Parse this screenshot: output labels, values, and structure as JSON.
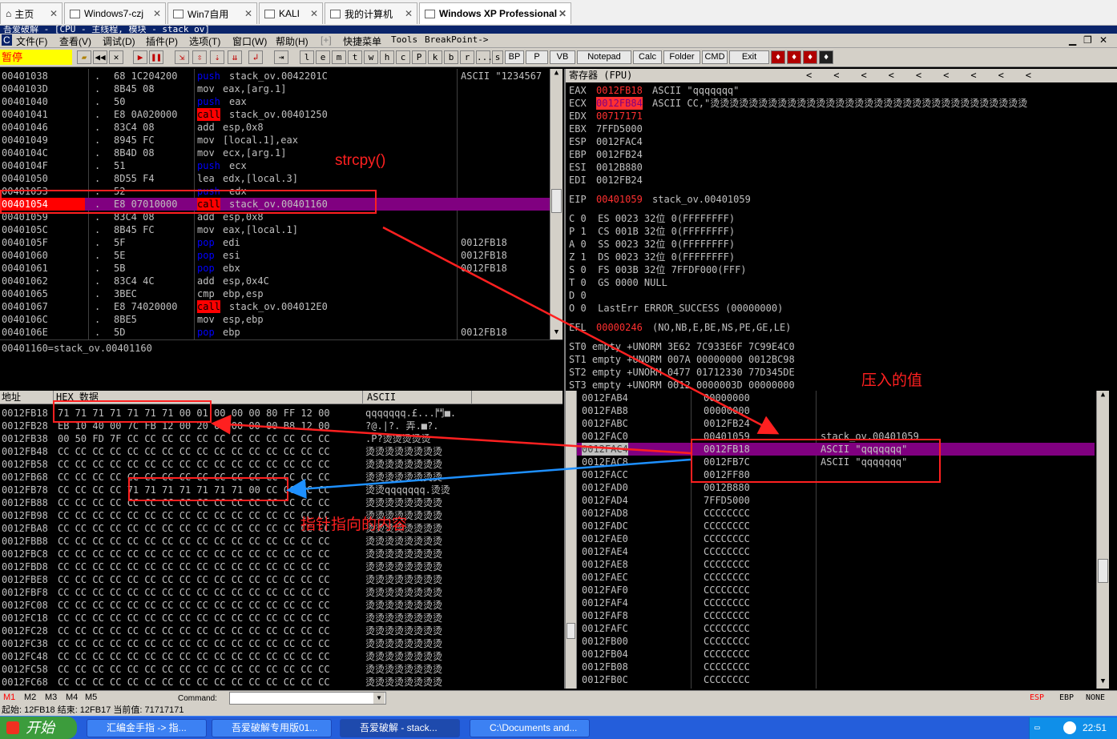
{
  "tabs": [
    {
      "label": "主页",
      "active": false
    },
    {
      "label": "Windows7-czj",
      "active": false
    },
    {
      "label": "Win7自用",
      "active": false
    },
    {
      "label": "KALI",
      "active": false
    },
    {
      "label": "我的计算机",
      "active": false
    },
    {
      "label": "Windows XP Professional",
      "active": true
    }
  ],
  "od_title": "吾爱破解 - [CPU - 主线程, 模块 - stack_ov]",
  "menu": [
    "文件(F)",
    "查看(V)",
    "调试(D)",
    "插件(P)",
    "选项(T)",
    "窗口(W)",
    "帮助(H)",
    "[+]",
    "快捷菜单",
    "Tools",
    "BreakPoint->"
  ],
  "toolbar": {
    "status": "暂停",
    "letters": [
      "l",
      "e",
      "m",
      "t",
      "w",
      "h",
      "c",
      "P",
      "k",
      "b",
      "r",
      "...",
      "s"
    ],
    "text_buttons": [
      "BP",
      "P",
      "VB",
      "Notepad",
      "Calc",
      "Folder",
      "CMD",
      "Exit"
    ]
  },
  "colors": {
    "eip_row": "#800080",
    "call": "#ff0000",
    "push": "#0000ff",
    "annot": "#ff2020",
    "arrow_blue": "#1e90ff"
  },
  "disasm": {
    "rows": [
      {
        "addr": "00401038",
        "mark": ".",
        "hex": "68 1C204200",
        "op": "push",
        "arg": "stack_ov.0042201C",
        "cmt": "ASCII \"1234567"
      },
      {
        "addr": "0040103D",
        "mark": ".",
        "hex": "8B45 08",
        "op": "mov",
        "arg": "eax,[arg.1]",
        "cmt": ""
      },
      {
        "addr": "00401040",
        "mark": ".",
        "hex": "50",
        "op": "push",
        "arg": "eax",
        "cmt": ""
      },
      {
        "addr": "00401041",
        "mark": ".",
        "hex": "E8 0A020000",
        "op": "call",
        "arg": "stack_ov.00401250",
        "cmt": ""
      },
      {
        "addr": "00401046",
        "mark": ".",
        "hex": "83C4 08",
        "op": "add",
        "arg": "esp,0x8",
        "cmt": ""
      },
      {
        "addr": "00401049",
        "mark": ".",
        "hex": "8945 FC",
        "op": "mov",
        "arg": "[local.1],eax",
        "cmt": ""
      },
      {
        "addr": "0040104C",
        "mark": ".",
        "hex": "8B4D 08",
        "op": "mov",
        "arg": "ecx,[arg.1]",
        "cmt": ""
      },
      {
        "addr": "0040104F",
        "mark": ".",
        "hex": "51",
        "op": "push",
        "arg": "ecx",
        "cmt": ""
      },
      {
        "addr": "00401050",
        "mark": ".",
        "hex": "8D55 F4",
        "op": "lea",
        "arg": "edx,[local.3]",
        "cmt": ""
      },
      {
        "addr": "00401053",
        "mark": ".",
        "hex": "52",
        "op": "push",
        "arg": "edx",
        "cmt": ""
      },
      {
        "addr": "00401054",
        "mark": ".",
        "hex": "E8 07010000",
        "op": "call",
        "arg": "stack_ov.00401160",
        "cmt": ""
      },
      {
        "addr": "00401059",
        "mark": ".",
        "hex": "83C4 08",
        "op": "add",
        "arg": "esp,0x8",
        "cmt": ""
      },
      {
        "addr": "0040105C",
        "mark": ".",
        "hex": "8B45 FC",
        "op": "mov",
        "arg": "eax,[local.1]",
        "cmt": ""
      },
      {
        "addr": "0040105F",
        "mark": ".",
        "hex": "5F",
        "op": "pop",
        "arg": "edi",
        "cmt": "0012FB18"
      },
      {
        "addr": "00401060",
        "mark": ".",
        "hex": "5E",
        "op": "pop",
        "arg": "esi",
        "cmt": "0012FB18"
      },
      {
        "addr": "00401061",
        "mark": ".",
        "hex": "5B",
        "op": "pop",
        "arg": "ebx",
        "cmt": "0012FB18"
      },
      {
        "addr": "00401062",
        "mark": ".",
        "hex": "83C4 4C",
        "op": "add",
        "arg": "esp,0x4C",
        "cmt": ""
      },
      {
        "addr": "00401065",
        "mark": ".",
        "hex": "3BEC",
        "op": "cmp",
        "arg": "ebp,esp",
        "cmt": ""
      },
      {
        "addr": "00401067",
        "mark": ".",
        "hex": "E8 74020000",
        "op": "call",
        "arg": "stack_ov.004012E0",
        "cmt": ""
      },
      {
        "addr": "0040106C",
        "mark": ".",
        "hex": "8BE5",
        "op": "mov",
        "arg": "esp,ebp",
        "cmt": ""
      },
      {
        "addr": "0040106E",
        "mark": ".",
        "hex": "5D",
        "op": "pop",
        "arg": "ebp",
        "cmt": "0012FB18"
      }
    ],
    "info": "00401160=stack_ov.00401160"
  },
  "registers": {
    "title": "寄存器 (FPU)",
    "gp": [
      {
        "name": "EAX",
        "val": "0012FB18",
        "note": "ASCII \"qqqqqqq\""
      },
      {
        "name": "ECX",
        "val": "0012FB84",
        "note": "ASCII CC,\"烫烫烫烫烫烫烫烫烫烫烫烫烫烫烫烫烫烫烫烫烫烫烫烫烫烫烫烫烫烫烫烫烫"
      },
      {
        "name": "EDX",
        "val": "00717171",
        "note": ""
      },
      {
        "name": "EBX",
        "val": "7FFD5000",
        "note": ""
      },
      {
        "name": "ESP",
        "val": "0012FAC4",
        "note": ""
      },
      {
        "name": "EBP",
        "val": "0012FB24",
        "note": ""
      },
      {
        "name": "ESI",
        "val": "0012B880",
        "note": ""
      },
      {
        "name": "EDI",
        "val": "0012FB24",
        "note": ""
      }
    ],
    "eip": {
      "name": "EIP",
      "val": "00401059",
      "note": "stack_ov.00401059"
    },
    "flags": [
      "C 0  ES 0023 32位 0(FFFFFFFF)",
      "P 1  CS 001B 32位 0(FFFFFFFF)",
      "A 0  SS 0023 32位 0(FFFFFFFF)",
      "Z 1  DS 0023 32位 0(FFFFFFFF)",
      "S 0  FS 003B 32位 7FFDF000(FFF)",
      "T 0  GS 0000 NULL",
      "D 0",
      "O 0  LastErr ERROR_SUCCESS (00000000)"
    ],
    "efl": {
      "name": "EFL",
      "val": "00000246",
      "note": "(NO,NB,E,BE,NS,PE,GE,LE)"
    },
    "fpu": [
      "ST0 empty +UNORM 3E62 7C933E6F 7C99E4C0",
      "ST1 empty +UNORM 007A 00000000 0012BC98",
      "ST2 empty +UNORM 0477 01712330 77D345DE",
      "ST3 empty +UNORM 0012 0000003D 00000000"
    ]
  },
  "dump": {
    "col_addr": "地址",
    "col_hex": "HEX 数据",
    "col_ascii": "ASCII",
    "rows": [
      {
        "addr": "0012FB18",
        "hex": "71 71 71 71 71 71 71 00 01 00 00 00 80 FF 12 00",
        "ascii": "qqqqqqq.£...鬥■."
      },
      {
        "addr": "0012FB28",
        "hex": "EB 10 40 00 7C FB 12 00 20 00 00 00 00 B8 12 00",
        "ascii": "?@.|?. 弄.■?."
      },
      {
        "addr": "0012FB38",
        "hex": "00 50 FD 7F CC CC CC CC CC CC CC CC CC CC CC CC",
        "ascii": ".P?烫烫烫烫烫"
      },
      {
        "addr": "0012FB48",
        "hex": "CC CC CC CC CC CC CC CC CC CC CC CC CC CC CC CC",
        "ascii": "烫烫烫烫烫烫烫烫"
      },
      {
        "addr": "0012FB58",
        "hex": "CC CC CC CC CC CC CC CC CC CC CC CC CC CC CC CC",
        "ascii": "烫烫烫烫烫烫烫烫"
      },
      {
        "addr": "0012FB68",
        "hex": "CC CC CC CC CC CC CC CC CC CC CC CC CC CC CC CC",
        "ascii": "烫烫烫烫烫烫烫烫"
      },
      {
        "addr": "0012FB78",
        "hex": "CC CC CC CC 71 71 71 71 71 71 71 00 CC CC CC CC",
        "ascii": "烫烫qqqqqqq.烫烫"
      },
      {
        "addr": "0012FB88",
        "hex": "CC CC CC CC CC CC CC CC CC CC CC CC CC CC CC CC",
        "ascii": "烫烫烫烫烫烫烫烫"
      },
      {
        "addr": "0012FB98",
        "hex": "CC CC CC CC CC CC CC CC CC CC CC CC CC CC CC CC",
        "ascii": "烫烫烫烫烫烫烫烫"
      },
      {
        "addr": "0012FBA8",
        "hex": "CC CC CC CC CC CC CC CC CC CC CC CC CC CC CC CC",
        "ascii": "烫烫烫烫烫烫烫烫"
      },
      {
        "addr": "0012FBB8",
        "hex": "CC CC CC CC CC CC CC CC CC CC CC CC CC CC CC CC",
        "ascii": "烫烫烫烫烫烫烫烫"
      },
      {
        "addr": "0012FBC8",
        "hex": "CC CC CC CC CC CC CC CC CC CC CC CC CC CC CC CC",
        "ascii": "烫烫烫烫烫烫烫烫"
      },
      {
        "addr": "0012FBD8",
        "hex": "CC CC CC CC CC CC CC CC CC CC CC CC CC CC CC CC",
        "ascii": "烫烫烫烫烫烫烫烫"
      },
      {
        "addr": "0012FBE8",
        "hex": "CC CC CC CC CC CC CC CC CC CC CC CC CC CC CC CC",
        "ascii": "烫烫烫烫烫烫烫烫"
      },
      {
        "addr": "0012FBF8",
        "hex": "CC CC CC CC CC CC CC CC CC CC CC CC CC CC CC CC",
        "ascii": "烫烫烫烫烫烫烫烫"
      },
      {
        "addr": "0012FC08",
        "hex": "CC CC CC CC CC CC CC CC CC CC CC CC CC CC CC CC",
        "ascii": "烫烫烫烫烫烫烫烫"
      },
      {
        "addr": "0012FC18",
        "hex": "CC CC CC CC CC CC CC CC CC CC CC CC CC CC CC CC",
        "ascii": "烫烫烫烫烫烫烫烫"
      },
      {
        "addr": "0012FC28",
        "hex": "CC CC CC CC CC CC CC CC CC CC CC CC CC CC CC CC",
        "ascii": "烫烫烫烫烫烫烫烫"
      },
      {
        "addr": "0012FC38",
        "hex": "CC CC CC CC CC CC CC CC CC CC CC CC CC CC CC CC",
        "ascii": "烫烫烫烫烫烫烫烫"
      },
      {
        "addr": "0012FC48",
        "hex": "CC CC CC CC CC CC CC CC CC CC CC CC CC CC CC CC",
        "ascii": "烫烫烫烫烫烫烫烫"
      },
      {
        "addr": "0012FC58",
        "hex": "CC CC CC CC CC CC CC CC CC CC CC CC CC CC CC CC",
        "ascii": "烫烫烫烫烫烫烫烫"
      },
      {
        "addr": "0012FC68",
        "hex": "CC CC CC CC CC CC CC CC CC CC CC CC CC CC CC CC",
        "ascii": "烫烫烫烫烫烫烫烫"
      }
    ]
  },
  "stack": {
    "rows": [
      {
        "addr": "0012FAB4",
        "val": "00000000",
        "cmt": ""
      },
      {
        "addr": "0012FAB8",
        "val": "00000000",
        "cmt": ""
      },
      {
        "addr": "0012FABC",
        "val": "0012FB24",
        "cmt": ""
      },
      {
        "addr": "0012FAC0",
        "val": "00401059",
        "cmt": "stack_ov.00401059"
      },
      {
        "addr": "0012FAC4",
        "val": "0012FB18",
        "cmt": "ASCII \"qqqqqqq\""
      },
      {
        "addr": "0012FAC8",
        "val": "0012FB7C",
        "cmt": "ASCII \"qqqqqqq\""
      },
      {
        "addr": "0012FACC",
        "val": "0012FF80",
        "cmt": ""
      },
      {
        "addr": "0012FAD0",
        "val": "0012B880",
        "cmt": ""
      },
      {
        "addr": "0012FAD4",
        "val": "7FFD5000",
        "cmt": ""
      },
      {
        "addr": "0012FAD8",
        "val": "CCCCCCCC",
        "cmt": ""
      },
      {
        "addr": "0012FADC",
        "val": "CCCCCCCC",
        "cmt": ""
      },
      {
        "addr": "0012FAE0",
        "val": "CCCCCCCC",
        "cmt": ""
      },
      {
        "addr": "0012FAE4",
        "val": "CCCCCCCC",
        "cmt": ""
      },
      {
        "addr": "0012FAE8",
        "val": "CCCCCCCC",
        "cmt": ""
      },
      {
        "addr": "0012FAEC",
        "val": "CCCCCCCC",
        "cmt": ""
      },
      {
        "addr": "0012FAF0",
        "val": "CCCCCCCC",
        "cmt": ""
      },
      {
        "addr": "0012FAF4",
        "val": "CCCCCCCC",
        "cmt": ""
      },
      {
        "addr": "0012FAF8",
        "val": "CCCCCCCC",
        "cmt": ""
      },
      {
        "addr": "0012FAFC",
        "val": "CCCCCCCC",
        "cmt": ""
      },
      {
        "addr": "0012FB00",
        "val": "CCCCCCCC",
        "cmt": ""
      },
      {
        "addr": "0012FB04",
        "val": "CCCCCCCC",
        "cmt": ""
      },
      {
        "addr": "0012FB08",
        "val": "CCCCCCCC",
        "cmt": ""
      },
      {
        "addr": "0012FB0C",
        "val": "CCCCCCCC",
        "cmt": ""
      }
    ]
  },
  "annotations": {
    "strcpy": "strcpy()",
    "pushed": "压入的值",
    "target": "指针指向的内容"
  },
  "cmdbar": {
    "tabs": [
      "M1",
      "M2",
      "M3",
      "M4",
      "M5"
    ],
    "command_label": "Command:",
    "command_value": "",
    "regs": [
      "ESP",
      "EBP",
      "NONE"
    ]
  },
  "status": "起始: 12FB18 结束: 12FB17 当前值: 71717171",
  "taskbar": {
    "start": "开始",
    "tasks": [
      "汇编金手指 -> 指...",
      "吾爱破解专用版01...",
      "吾爱破解 - stack...",
      "C:\\Documents and..."
    ],
    "clock": "22:51"
  }
}
